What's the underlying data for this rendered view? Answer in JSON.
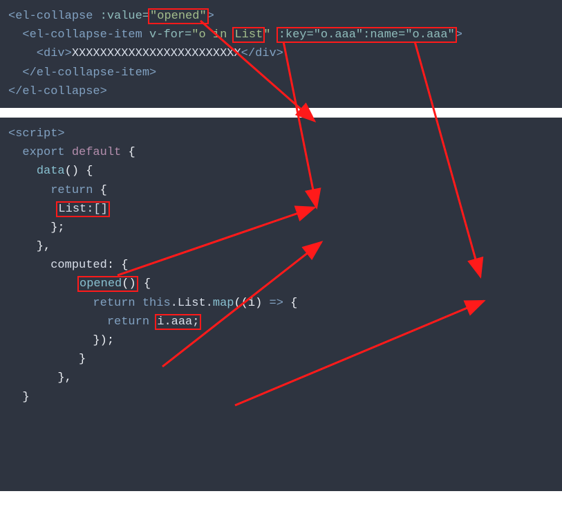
{
  "top": {
    "l1a": "<el-collapse ",
    "l1b": ":value=",
    "l1c_open": "\"",
    "l1c": "opened",
    "l1c_close": "\"",
    "l1d": ">",
    "l2a": "  <el-collapse-item ",
    "l2b": "v-for=",
    "l2c": "\"o in ",
    "l2d": "List",
    "l2e": "\" ",
    "l2f": ":key=\"o.aaa\":name=\"o.aaa\"",
    "l2g": ">",
    "l3a": "    <div>",
    "l3b": "XXXXXXXXXXXXXXXXXXXXXXXX",
    "l3c": "</div>",
    "l4": "  </el-collapse-item>",
    "l5": "</el-collapse>"
  },
  "bot": {
    "l1": "<script>",
    "l2a": "  export",
    "l2b": " default",
    "l2c": " {",
    "l3a": "    ",
    "l3b": "data",
    "l3c": "() {",
    "l4a": "      return",
    "l4b": " {",
    "l5a": "       ",
    "l5b": "List:[]",
    "l6": "      };",
    "l7": "    },",
    "l8a": "      ",
    "l8b": "computed",
    "l8c": ": {",
    "l9a": "          ",
    "l9b": "opened",
    "l9c": "()",
    "l9d": " {",
    "l10a": "            return",
    "l10b": " this",
    "l10c": ".List.",
    "l10d": "map",
    "l10e": "((i) ",
    "l10f": "=>",
    "l10g": " {",
    "l11a": "              return ",
    "l11b": "i.aaa;",
    "l12": "            });",
    "l13": "          }",
    "l14": "       },",
    "l15": "  }"
  }
}
